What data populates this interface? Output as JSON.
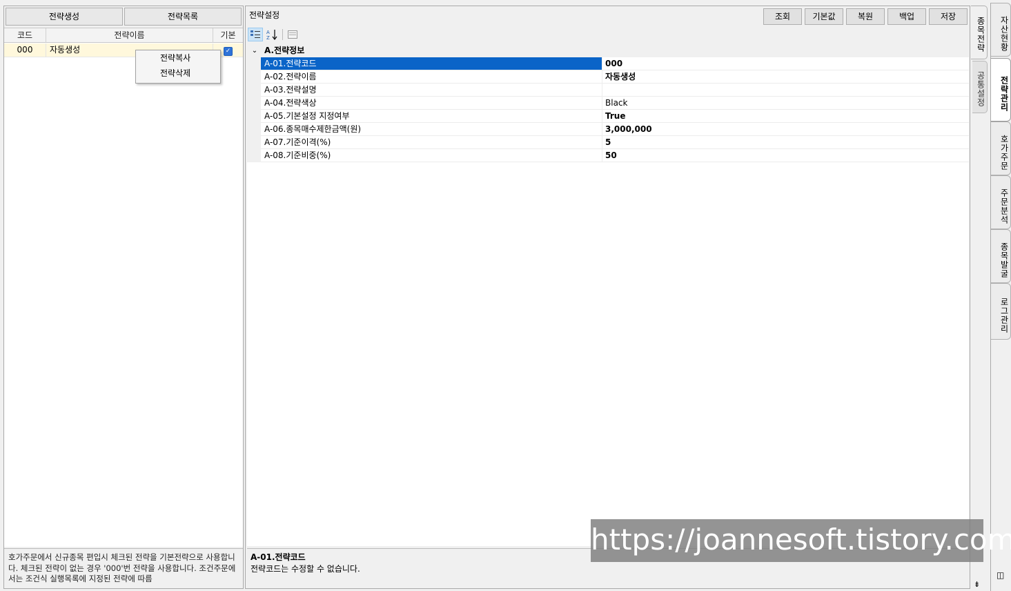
{
  "left": {
    "create_label": "전략생성",
    "list_label": "전략목록",
    "columns": [
      "코드",
      "전략이름",
      "기본"
    ],
    "rows": [
      {
        "code": "000",
        "name": "자동생성",
        "default_checked": true
      }
    ],
    "context_menu": [
      "전략복사",
      "전략삭제"
    ],
    "info_text": "호가주문에서 신규종목 편입시 체크된 전략을 기본전략으로 사용합니다. 체크된 전략이 없는 경우 '000'번 전략을 사용합니다. 조건주문에서는 조건식 실행목록에 지정된 전략에 따름"
  },
  "right": {
    "title": "전략설정",
    "buttons": [
      "조회",
      "기본값",
      "복원",
      "백업",
      "저장"
    ],
    "toolbar_icons": [
      "categorized-icon",
      "sort-az-icon",
      "property-pages-icon"
    ],
    "category": "A.전략정보",
    "properties": [
      {
        "name": "A-01.전략코드",
        "value": "000",
        "bold": true,
        "selected": true
      },
      {
        "name": "A-02.전략이름",
        "value": "자동생성",
        "bold": true,
        "selected": false
      },
      {
        "name": "A-03.전략설명",
        "value": "",
        "bold": false,
        "selected": false
      },
      {
        "name": "A-04.전략색상",
        "value": "Black",
        "bold": false,
        "selected": false
      },
      {
        "name": "A-05.기본설정 지정여부",
        "value": "True",
        "bold": true,
        "selected": false
      },
      {
        "name": "A-06.종목매수제한금액(원)",
        "value": "3,000,000",
        "bold": true,
        "selected": false
      },
      {
        "name": "A-07.기준이격(%)",
        "value": "5",
        "bold": true,
        "selected": false
      },
      {
        "name": "A-08.기준비중(%)",
        "value": "50",
        "bold": true,
        "selected": false
      }
    ],
    "help_title": "A-01.전략코드",
    "help_text": "전략코드는 수정할 수 없습니다."
  },
  "inner_tabs": [
    "종목전략",
    "공통설정"
  ],
  "side_tabs": [
    "자산현황",
    "전략관리",
    "호가주문",
    "주문분석",
    "종목발굴",
    "로그관리"
  ],
  "active_side_tab": "전략관리",
  "watermark": "https://joannesoft.tistory.com",
  "colors": {
    "selection": "#0a64c8",
    "row_highlight": "#fff8dc",
    "check": "#2f73d8"
  }
}
